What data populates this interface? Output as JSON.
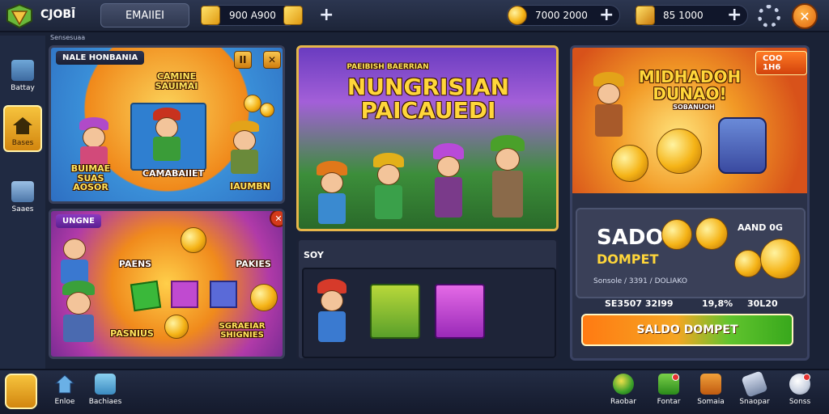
{
  "header": {
    "brand": "CJOBĪ",
    "tab_label": "EMAIIEI",
    "currency_a": "900 A900",
    "currency_b": "7000 2000",
    "currency_c": "85   1000",
    "sub_label": "Sensesuaa"
  },
  "sidebar": {
    "items": [
      {
        "label": "Battay",
        "icon": "battle-icon"
      },
      {
        "label": "Bases",
        "icon": "home-icon"
      },
      {
        "label": "Saaes",
        "icon": "store-icon"
      }
    ]
  },
  "panel_left_top": {
    "tag": "NALE HONBANIA",
    "text_top": "CAMINE\nSAUIMAI",
    "text_left": "BUIMAE\nSUAS\nAOSOR",
    "text_mid": "CAMABAIIET",
    "text_right": "IAUMBN"
  },
  "panel_left_bottom": {
    "tag": "UNGNE",
    "text_a": "PAENS",
    "text_b": "PAKIES",
    "text_c": "PASNIUS",
    "text_d": "SGRAEIAR\nSHIGNIES"
  },
  "panel_center_top": {
    "small_title": "PAEIBISH BAERRIAN",
    "title": "NUNGRISIAN\nPAICAUEDI"
  },
  "panel_center_bottom": {
    "label": "SOY"
  },
  "panel_right": {
    "price_tag": "COO 1H6",
    "title": "MIDHADOH\nDUNAO!",
    "subtitle": "SOBANUOH",
    "sado": "SADO",
    "dompet": "DOMPET",
    "aand": "AAND 0G",
    "detail": "Sonsole / 3391 / DOLIAKO",
    "stat1": "SE3507  32I99",
    "stat2": "19,8%",
    "stat3": "30L20",
    "cta": "SALDO DOMPET"
  },
  "bottombar": {
    "left": [
      {
        "label": "Enloe",
        "icon": "house-icon"
      },
      {
        "label": "Bachiaes",
        "icon": "bird-icon"
      }
    ],
    "right": [
      {
        "label": "Raobar",
        "icon": "ball-icon"
      },
      {
        "label": "Fontar",
        "icon": "gift-icon"
      },
      {
        "label": "Somaia",
        "icon": "map-icon"
      },
      {
        "label": "Snaopar",
        "icon": "sword-icon"
      },
      {
        "label": "Sonss",
        "icon": "sphere-icon"
      }
    ]
  }
}
